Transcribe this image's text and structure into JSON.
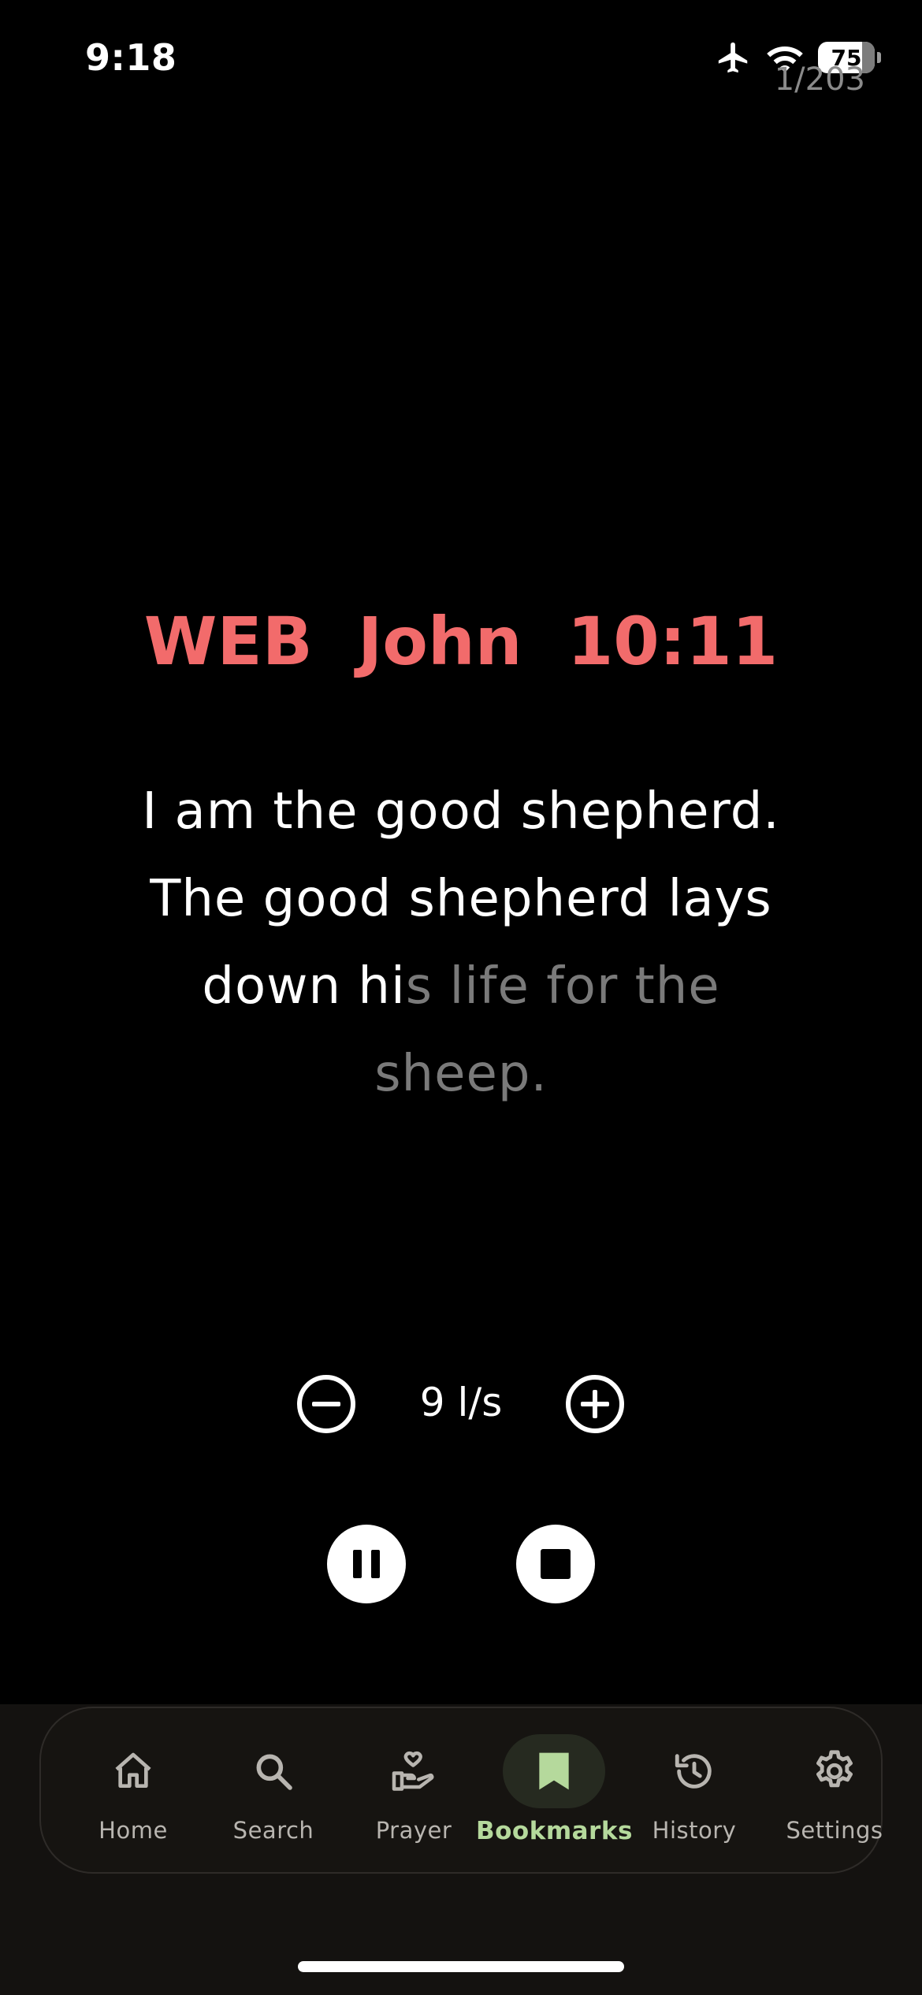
{
  "status_bar": {
    "time": "9:18",
    "battery": "75",
    "icons": [
      "airplane-icon",
      "wifi-icon",
      "battery-icon"
    ]
  },
  "reader": {
    "counter": "1/203",
    "translation": "WEB",
    "reference": "John 10:11",
    "verse_read": "I am the good shepherd. The good shepherd lays down hi",
    "verse_unread": "s life for the sheep.",
    "progress_fraction": 0.64
  },
  "speed": {
    "value": "9 l/s",
    "decrease_icon": "minus-circle-icon",
    "increase_icon": "plus-circle-icon"
  },
  "playback": {
    "pause_icon": "pause-icon",
    "stop_icon": "stop-icon"
  },
  "nav": {
    "items": [
      {
        "label": "Home",
        "icon": "home-icon",
        "active": false
      },
      {
        "label": "Search",
        "icon": "search-icon",
        "active": false
      },
      {
        "label": "Prayer",
        "icon": "prayer-hand-heart-icon",
        "active": false
      },
      {
        "label": "Bookmarks",
        "icon": "bookmark-icon",
        "active": true
      },
      {
        "label": "History",
        "icon": "history-icon",
        "active": false
      },
      {
        "label": "Settings",
        "icon": "gear-icon",
        "active": false
      }
    ]
  },
  "colors": {
    "reference": "#f26b6b",
    "unread_text": "#7a7a7a",
    "nav_active": "#b5d99c",
    "nav_background": "#141210"
  }
}
